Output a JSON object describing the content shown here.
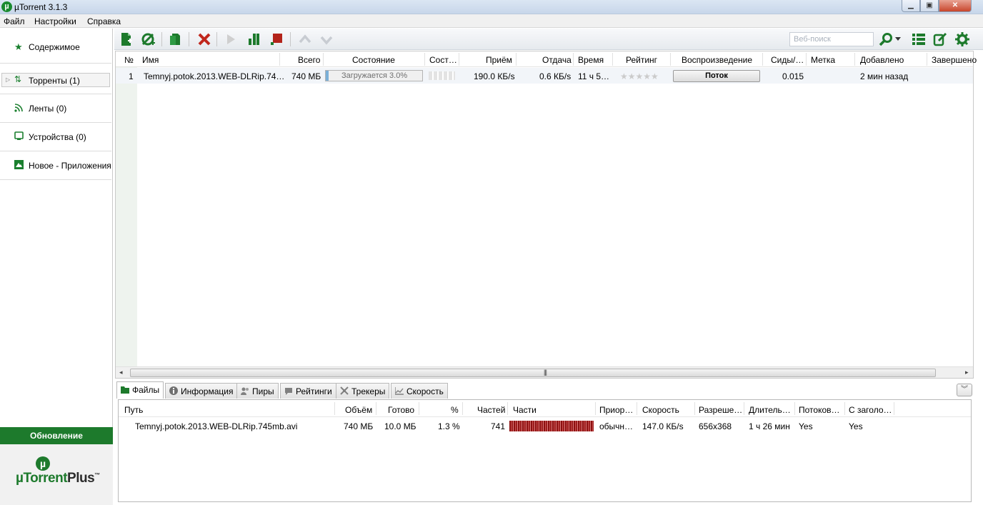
{
  "window": {
    "title": "µTorrent 3.1.3",
    "app_icon": "µ",
    "minimize": "▁",
    "maximize": "▣",
    "close": "✕"
  },
  "menu": [
    "Файл",
    "Настройки",
    "Справка"
  ],
  "sidebar": {
    "items": [
      {
        "label": "Содержимое",
        "icon": "star-icon"
      },
      {
        "label": "Торренты (1)",
        "icon": "torrents-icon"
      },
      {
        "label": "Ленты (0)",
        "icon": "rss-icon"
      },
      {
        "label": "Устройства (0)",
        "icon": "device-icon"
      },
      {
        "label": "Новое - Приложения",
        "icon": "apps-icon"
      }
    ],
    "update_label": "Обновление",
    "plus_logo_main": "µTorrent",
    "plus_logo_suffix": "Plus",
    "plus_logo_tm": "™"
  },
  "toolbar": {
    "search_placeholder": "Веб-поиск"
  },
  "torrent_list": {
    "columns": [
      "№",
      "Имя",
      "Всего",
      "Состояние",
      "Сост…",
      "Приём",
      "Отдача",
      "Время",
      "Рейтинг",
      "Воспроизведение",
      "Сиды/…",
      "Метка",
      "Добавлено",
      "Завершено"
    ],
    "rows": [
      {
        "num": "1",
        "name": "Temnyj.potok.2013.WEB-DLRip.74…",
        "size": "740 МБ",
        "status": "Загружается 3.0%",
        "progress": 0.03,
        "down": "190.0 КБ/s",
        "up": "0.6 КБ/s",
        "time": "11 ч 5…",
        "rating": "★★★★★",
        "stream_btn": "Поток",
        "ratio": "0.015",
        "label": "",
        "added": "2 мин назад",
        "completed": ""
      }
    ]
  },
  "tabs": [
    "Файлы",
    "Информация",
    "Пиры",
    "Рейтинги",
    "Трекеры",
    "Скорость"
  ],
  "collapse_icon": "︾",
  "files": {
    "columns": [
      "Путь",
      "Объём",
      "Готово",
      "%",
      "Частей",
      "Части",
      "Приор…",
      "Скорость",
      "Разреше…",
      "Длитель…",
      "Потоков…",
      "С заголо…"
    ],
    "rows": [
      {
        "path": "Temnyj.potok.2013.WEB-DLRip.745mb.avi",
        "size": "740 МБ",
        "done": "10.0 МБ",
        "percent": "1.3 %",
        "pieces": "741",
        "priority": "обычн…",
        "speed": "147.0 КБ/s",
        "resolution": "656x368",
        "duration": "1 ч 26 мин",
        "streamable": "Yes",
        "header": "Yes"
      }
    ]
  },
  "colors": {
    "accent_green": "#1d7a2c",
    "delete_red": "#c0271d",
    "titlebar": "#cfdcec"
  }
}
